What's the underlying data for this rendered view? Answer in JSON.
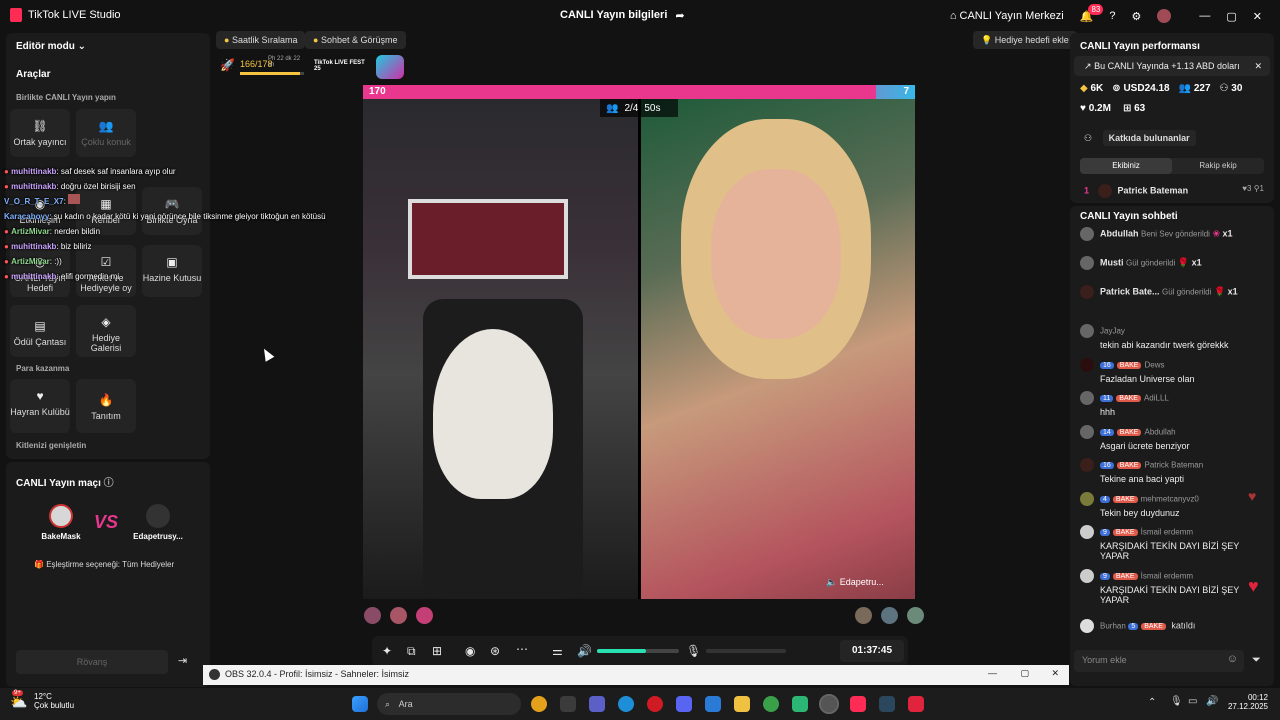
{
  "titlebar": {
    "app_name": "TikTok LIVE Studio",
    "center_title": "CANLI Yayın bilgileri",
    "center_link": "CANLI Yayın Merkezi",
    "notif_count": "83"
  },
  "left": {
    "editor_mode": "Editör modu",
    "tools_title": "Araçlar",
    "together_title": "Birlikte CANLI Yayın yapın",
    "tools": [
      "Ortak yayıncı",
      "Çoklu konuk",
      "Etkinleşim",
      "Rehber",
      "Birlikte Oyna",
      "CANLI Yayın Hedefi",
      "Anket ve Hediyeyle oy",
      "Hazine Kutusu",
      "Ödül Çantası",
      "Hediye Galerisi"
    ],
    "monetize_title": "Para kazanma",
    "monetize": [
      "Hayran Kulübü",
      "Tanıtım"
    ],
    "expand_title": "Kitlenizi genişletin"
  },
  "match": {
    "title": "CANLI Yayın maçı",
    "p1": "BakeMask",
    "vs": "VS",
    "p2": "Edapetrusy...",
    "pairing": "Eşleştirme seçeneği: Tüm Hediyeler",
    "rematch": "Rövanş"
  },
  "overlay_chat": [
    {
      "user": "muhittinakb",
      "text": ": saf desek saf insanlara ayıp olur",
      "cls": "u"
    },
    {
      "user": "muhittinakb",
      "text": ": doğru özel birisiji sen",
      "cls": "u"
    },
    {
      "user": "V_O_R_T_E_X7",
      "text": ":",
      "cls": "u b"
    },
    {
      "user": "Karacaboyy",
      "text": ": şu kadın o kadar kötü ki yani görünce bile tiksinme gleiyor tiktoğun en kötüsü",
      "cls": "u b"
    },
    {
      "user": "ArtizMivar",
      "text": ": nerden bildin",
      "cls": "u g"
    },
    {
      "user": "muhittinakb",
      "text": ": biz biliriz",
      "cls": "u"
    },
    {
      "user": "ArtizMivar",
      "text": ": :))",
      "cls": "u g"
    },
    {
      "user": "muhittinakb",
      "text": ": elifi gormedin mi",
      "cls": "u"
    }
  ],
  "top_chips": {
    "ranking": "Saatlik Sıralama",
    "chat": "Sohbet & Görüşme",
    "goal": "Hediye hedefi ekle"
  },
  "progress": {
    "value": "166/178",
    "sub": "Ph 22 dk 22 sn",
    "fest": "TikTok LIVE FEST 25",
    "fraction": 0.93
  },
  "battle": {
    "left_score": "170",
    "right_score": "7",
    "guests": "2/4",
    "timer": "50s",
    "guest_name": "Edapetru...",
    "left_share": 0.93
  },
  "controls": {
    "elapsed": "01:37:45",
    "volume": 0.6
  },
  "perf": {
    "title": "CANLI Yayın performansı",
    "banner": "Bu CANLI Yayında +1.13 ABD doları",
    "stats": [
      "6K",
      "USD24.18",
      "227",
      "30",
      "0.2M",
      "63"
    ],
    "contributors": "Katkıda bulunanlar",
    "tab_team": "Ekibiniz",
    "tab_rival": "Rakip ekip",
    "rank": "1",
    "top_user": "Patrick Bateman",
    "top_count1": "3",
    "top_count2": "1"
  },
  "chat": {
    "title": "CANLI Yayın sohbeti",
    "gifts": [
      {
        "user": "Abdullah",
        "text": "Beni Sev gönderildi",
        "qty": "x1"
      },
      {
        "user": "Musti",
        "text": "Gül gönderildi",
        "qty": "x1"
      },
      {
        "user": "Patrick Bate...",
        "text": "Gül gönderildi",
        "qty": "x1"
      }
    ],
    "messages": [
      {
        "lvl": "",
        "fan": "",
        "user": "JayJay",
        "text": "tekin abi kazandır twerk görekkk"
      },
      {
        "lvl": "16",
        "fan": "BAKE",
        "user": "Dews",
        "text": "Fazladan Universe olan"
      },
      {
        "lvl": "11",
        "fan": "BAKE",
        "user": "AdiLLL",
        "text": "hhh"
      },
      {
        "lvl": "14",
        "fan": "BAKE",
        "user": "Abdullah",
        "text": "Asgari ücrete benziyor"
      },
      {
        "lvl": "16",
        "fan": "BAKE",
        "user": "Patrick Bateman",
        "text": "Tekine ana baci yapti"
      },
      {
        "lvl": "4",
        "fan": "BAKE",
        "user": "mehmetcanyvz0",
        "text": "Tekin bey duydunuz"
      },
      {
        "lvl": "9",
        "fan": "BAKE",
        "user": "İsmail erdemm",
        "text": "KARŞIDAKİ TEKİN DAYI BİZİ ŞEY YAPAR"
      },
      {
        "lvl": "9",
        "fan": "BAKE",
        "user": "İsmail erdemm",
        "text": "KARŞIDAKİ TEKİN DAYI BİZİ ŞEY YAPAR"
      },
      {
        "lvl": "5",
        "fan": "BAKE",
        "user": "Burhan",
        "text": "katıldı"
      }
    ],
    "placeholder": "Yorum ekle"
  },
  "obs": {
    "title": "OBS 32.0.4 - Profil: İsimsiz - Sahneler: İsimsiz"
  },
  "taskbar": {
    "temp": "12°C",
    "weather": "Çok bulutlu",
    "search": "Ara",
    "time": "00:12",
    "date": "27.12.2025",
    "weather_badge": "9+"
  }
}
